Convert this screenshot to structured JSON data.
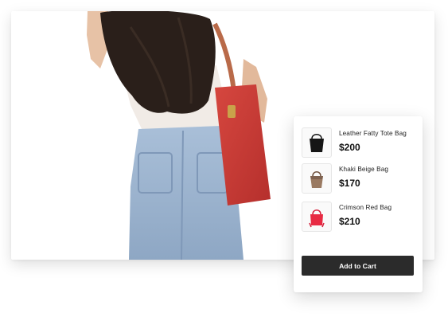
{
  "products": [
    {
      "name": "Leather Fatty Tote Bag",
      "price": "$200",
      "icon": "black-tote-bag-icon"
    },
    {
      "name": "Khaki Beige Bag",
      "price": "$170",
      "icon": "beige-bag-icon"
    },
    {
      "name": "Crimson Red Bag",
      "price": "$210",
      "icon": "red-bag-icon"
    }
  ],
  "cart": {
    "button_label": "Add to Cart"
  },
  "colors": {
    "button": "#2b2b2b",
    "red_bag": "#cc3b37",
    "denim": "#9cb4cf"
  }
}
